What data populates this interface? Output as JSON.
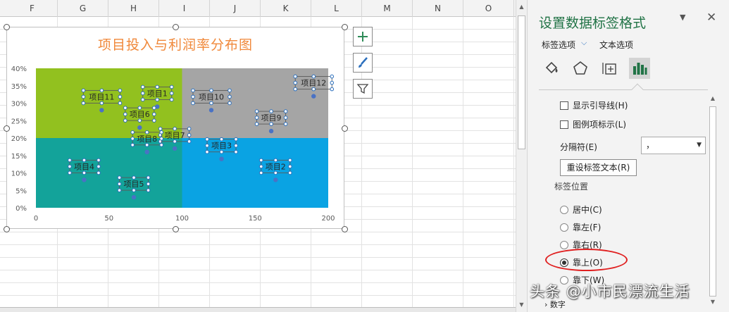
{
  "sheet": {
    "columns": [
      "F",
      "G",
      "H",
      "I",
      "J",
      "K",
      "L",
      "M",
      "N",
      "O"
    ]
  },
  "chart": {
    "side_buttons": [
      "plus-icon",
      "brush-icon",
      "filter-icon"
    ]
  },
  "chart_data": {
    "type": "scatter",
    "title": "项目投入与利润率分布图",
    "xlim": [
      0,
      200
    ],
    "ylim": [
      0,
      0.4
    ],
    "x_ticks": [
      "0",
      "50",
      "100",
      "150",
      "200"
    ],
    "y_ticks": [
      "0%",
      "5%",
      "10%",
      "15%",
      "20%",
      "25%",
      "30%",
      "35%",
      "40%"
    ],
    "quadrants": [
      {
        "x": [
          0,
          100
        ],
        "y": [
          0.2,
          0.4
        ],
        "color": "#92c11f"
      },
      {
        "x": [
          100,
          200
        ],
        "y": [
          0.2,
          0.4
        ],
        "color": "#a5a5a5"
      },
      {
        "x": [
          0,
          100
        ],
        "y": [
          0,
          0.2
        ],
        "color": "#13a39a"
      },
      {
        "x": [
          100,
          200
        ],
        "y": [
          0,
          0.2
        ],
        "color": "#0aa3e3"
      }
    ],
    "points": [
      {
        "label": "项目1",
        "x": 83,
        "y": 0.29
      },
      {
        "label": "项目2",
        "x": 164,
        "y": 0.08
      },
      {
        "label": "项目3",
        "x": 127,
        "y": 0.14
      },
      {
        "label": "项目4",
        "x": 33,
        "y": 0.08
      },
      {
        "label": "项目5",
        "x": 67,
        "y": 0.03
      },
      {
        "label": "项目6",
        "x": 71,
        "y": 0.23
      },
      {
        "label": "项目7",
        "x": 95,
        "y": 0.17
      },
      {
        "label": "项目8",
        "x": 76,
        "y": 0.16
      },
      {
        "label": "项目9",
        "x": 161,
        "y": 0.22
      },
      {
        "label": "项目10",
        "x": 120,
        "y": 0.28
      },
      {
        "label": "项目11",
        "x": 45,
        "y": 0.28
      },
      {
        "label": "项目12",
        "x": 190,
        "y": 0.32
      }
    ],
    "grid": false,
    "legend": "none"
  },
  "pane": {
    "title": "设置数据标签格式",
    "dropdown_icon": "▼",
    "close_icon": "✕",
    "tab_label": "标签选项",
    "tab_chevron": "⌵",
    "tab_text_options": "文本选项",
    "icons": [
      "fill-bucket-icon",
      "pentagon-icon",
      "size-properties-icon",
      "bar-chart-icon"
    ],
    "checkboxes": [
      {
        "label": "显示引导线(H)",
        "checked": false
      },
      {
        "label": "图例项标示(L)",
        "checked": false
      }
    ],
    "separator_label": "分隔符(E)",
    "separator_value": "，",
    "reset_button": "重设标签文本(R)",
    "position_label": "标签位置",
    "radios": [
      {
        "label": "居中(C)",
        "checked": false
      },
      {
        "label": "靠左(F)",
        "checked": false
      },
      {
        "label": "靠右(R)",
        "checked": false
      },
      {
        "label": "靠上(O)",
        "checked": true
      },
      {
        "label": "靠下(W)",
        "checked": false
      }
    ],
    "bottom_section": "› 数字"
  },
  "watermark": "头条 @小市民漂流生活"
}
